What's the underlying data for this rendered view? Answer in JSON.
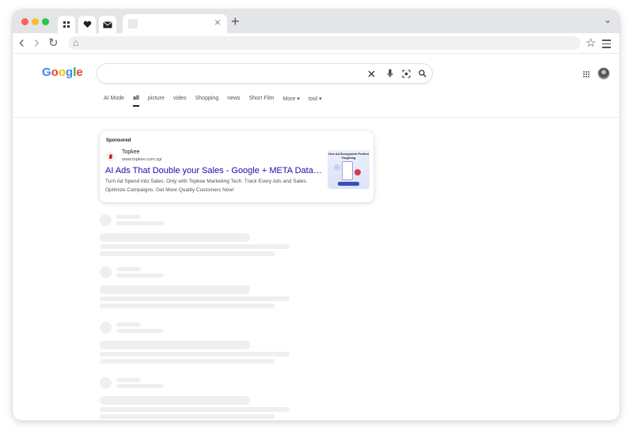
{
  "browser": {
    "tab_close": "×",
    "new_tab": "+",
    "tab_menu": "⌄",
    "icons": [
      "apps-icon",
      "heart-icon",
      "mail-icon"
    ],
    "nav": {
      "back": "‹",
      "forward": "›",
      "reload": "↻",
      "home": "⌂",
      "star": "☆"
    }
  },
  "google": {
    "logo": [
      "G",
      "o",
      "o",
      "g",
      "l",
      "e"
    ],
    "logo_colors": [
      "#4285F4",
      "#EA4335",
      "#FBBC05",
      "#4285F4",
      "#34A853",
      "#EA4335"
    ],
    "search_value": "",
    "tabs": [
      {
        "label": "AI Mode"
      },
      {
        "label": "all",
        "active": true
      },
      {
        "label": "picture"
      },
      {
        "label": "video"
      },
      {
        "label": "Shopping"
      },
      {
        "label": "news"
      },
      {
        "label": "Short Film"
      },
      {
        "label": "More ▾"
      },
      {
        "label": "tool ▾"
      }
    ]
  },
  "ad": {
    "sponsored": "Sponsored",
    "name": "Topkee",
    "url": "www.topkee.com.sg/",
    "title": "AI Ads That Double your Sales - Google + META Data, M…",
    "description": "Turn Ad Spend into Sales. Only with Topkee Marketing Tech. Track Every Ads and Sales. Optimize Campaigns. Get More Quality Customers Now!",
    "image_text": "One Ad Ecosystem Perfect Targeting"
  }
}
